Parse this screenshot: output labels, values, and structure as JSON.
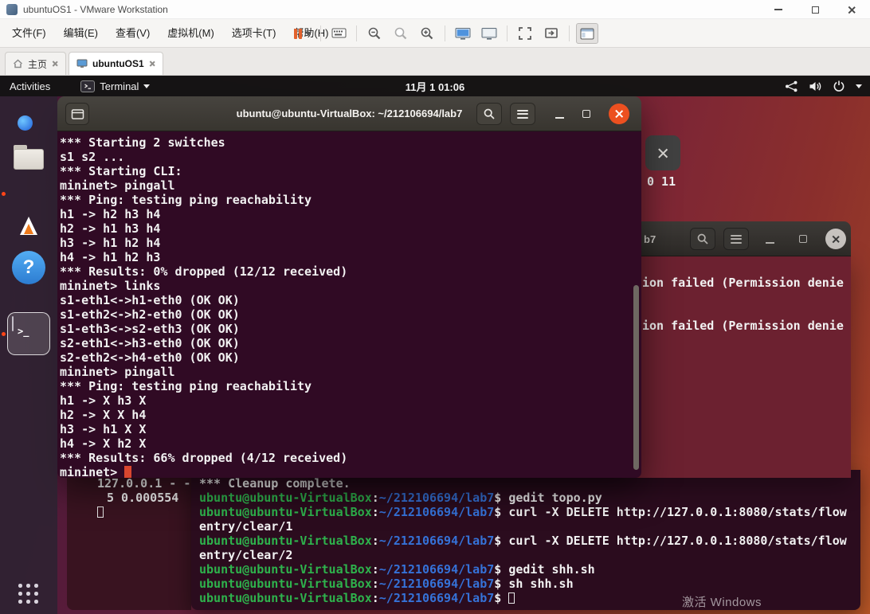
{
  "host_window": {
    "title": "ubuntuOS1 - VMware Workstation",
    "menu_items": [
      "文件(F)",
      "编辑(E)",
      "查看(V)",
      "虚拟机(M)",
      "选项卡(T)",
      "帮助(H)"
    ],
    "tabs": [
      {
        "label": "主页"
      },
      {
        "label": "ubuntuOS1"
      }
    ]
  },
  "guest_topbar": {
    "activities_label": "Activities",
    "app_menu_label": "Terminal",
    "clock": "11月 1 01:06"
  },
  "dock_items": [
    "firefox",
    "files",
    "ubuntu-software",
    "help",
    "terminal",
    "show-applications"
  ],
  "front_terminal": {
    "title": "ubuntu@ubuntu-VirtualBox: ~/212106694/lab7",
    "cursor_color": "#d9472f",
    "lines": [
      "*** Starting 2 switches",
      "s1 s2 ...",
      "*** Starting CLI:",
      "mininet> pingall",
      "*** Ping: testing ping reachability",
      "h1 -> h2 h3 h4",
      "h2 -> h1 h3 h4",
      "h3 -> h1 h2 h4",
      "h4 -> h1 h2 h3",
      "*** Results: 0% dropped (12/12 received)",
      "mininet> links",
      "s1-eth1<->h1-eth0 (OK OK)",
      "s1-eth2<->h2-eth0 (OK OK)",
      "s1-eth3<->s2-eth3 (OK OK)",
      "s2-eth1<->h3-eth0 (OK OK)",
      "s2-eth2<->h4-eth0 (OK OK)",
      "mininet> pingall",
      "*** Ping: testing ping reachability",
      "h1 -> X h3 X",
      "h2 -> X X h4",
      "h3 -> h1 X X",
      "h4 -> X h2 X",
      "*** Results: 66% dropped (4/12 received)",
      "mininet> "
    ]
  },
  "back_terminal": {
    "title_fragment": "b7",
    "error_lines": [
      "ion failed (Permission denie",
      "ion failed (Permission denie"
    ],
    "output_line": "*** Cleanup complete.",
    "prompt": {
      "user": "ubuntu@ubuntu-VirtualBox",
      "separator": ":",
      "path": "~/212106694/lab7",
      "sigil": "$"
    },
    "colors": {
      "user": "#2eb24c",
      "path": "#3572d8",
      "text": "#f2f2f2"
    },
    "history": [
      {
        "command": "gedit topo.py"
      },
      {
        "command": "curl -X DELETE http://127.0.0.1:8080/stats/flow",
        "wrap": "entry/clear/1"
      },
      {
        "command": "curl -X DELETE http://127.0.0.1:8080/stats/flow",
        "wrap": "entry/clear/2"
      },
      {
        "command": "gedit shh.sh"
      },
      {
        "command": "sh shh.sh"
      },
      {
        "command": "",
        "cursor": true
      }
    ]
  },
  "backmost_terminal": {
    "lines": [
      "127.0.0.1 - -",
      "5 0.000554"
    ]
  },
  "overlay_fragment": {
    "text": "0 11"
  },
  "watermark": "激活 Windows"
}
